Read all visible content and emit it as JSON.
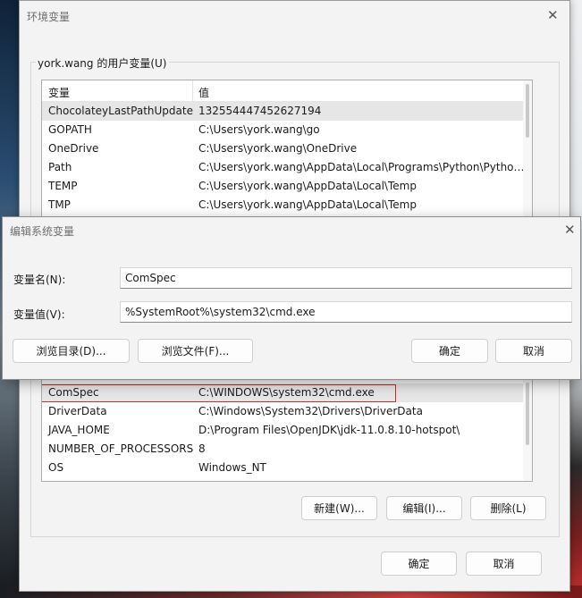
{
  "env_dialog": {
    "title": "环境变量",
    "close_icon": "close-icon",
    "user_group_label": "york.wang 的用户变量(U)",
    "user_vars": {
      "headers": [
        "变量",
        "值"
      ],
      "rows": [
        {
          "name": "ChocolateyLastPathUpdate",
          "value": "132554447452627194"
        },
        {
          "name": "GOPATH",
          "value": "C:\\Users\\york.wang\\go"
        },
        {
          "name": "OneDrive",
          "value": "C:\\Users\\york.wang\\OneDrive"
        },
        {
          "name": "Path",
          "value": "C:\\Users\\york.wang\\AppData\\Local\\Programs\\Python\\Python..."
        },
        {
          "name": "TEMP",
          "value": "C:\\Users\\york.wang\\AppData\\Local\\Temp"
        },
        {
          "name": "TMP",
          "value": "C:\\Users\\york.wang\\AppData\\Local\\Temp"
        }
      ]
    },
    "system_vars": {
      "rows": [
        {
          "name": "ComSpec",
          "value": "C:\\WINDOWS\\system32\\cmd.exe"
        },
        {
          "name": "DriverData",
          "value": "C:\\Windows\\System32\\Drivers\\DriverData"
        },
        {
          "name": "JAVA_HOME",
          "value": "D:\\Program Files\\OpenJDK\\jdk-11.0.8.10-hotspot\\"
        },
        {
          "name": "NUMBER_OF_PROCESSORS",
          "value": "8"
        },
        {
          "name": "OS",
          "value": "Windows_NT"
        }
      ]
    },
    "buttons": {
      "new": "新建(W)...",
      "edit": "编辑(I)...",
      "delete": "删除(L)",
      "ok": "确定",
      "cancel": "取消"
    }
  },
  "edit_dialog": {
    "title": "编辑系统变量",
    "close_icon": "close-icon",
    "name_label": "变量名(N):",
    "name_value": "ComSpec",
    "value_label": "变量值(V):",
    "value_value": "%SystemRoot%\\system32\\cmd.exe",
    "buttons": {
      "browse_dir": "浏览目录(D)...",
      "browse_file": "浏览文件(F)...",
      "ok": "确定",
      "cancel": "取消"
    }
  }
}
